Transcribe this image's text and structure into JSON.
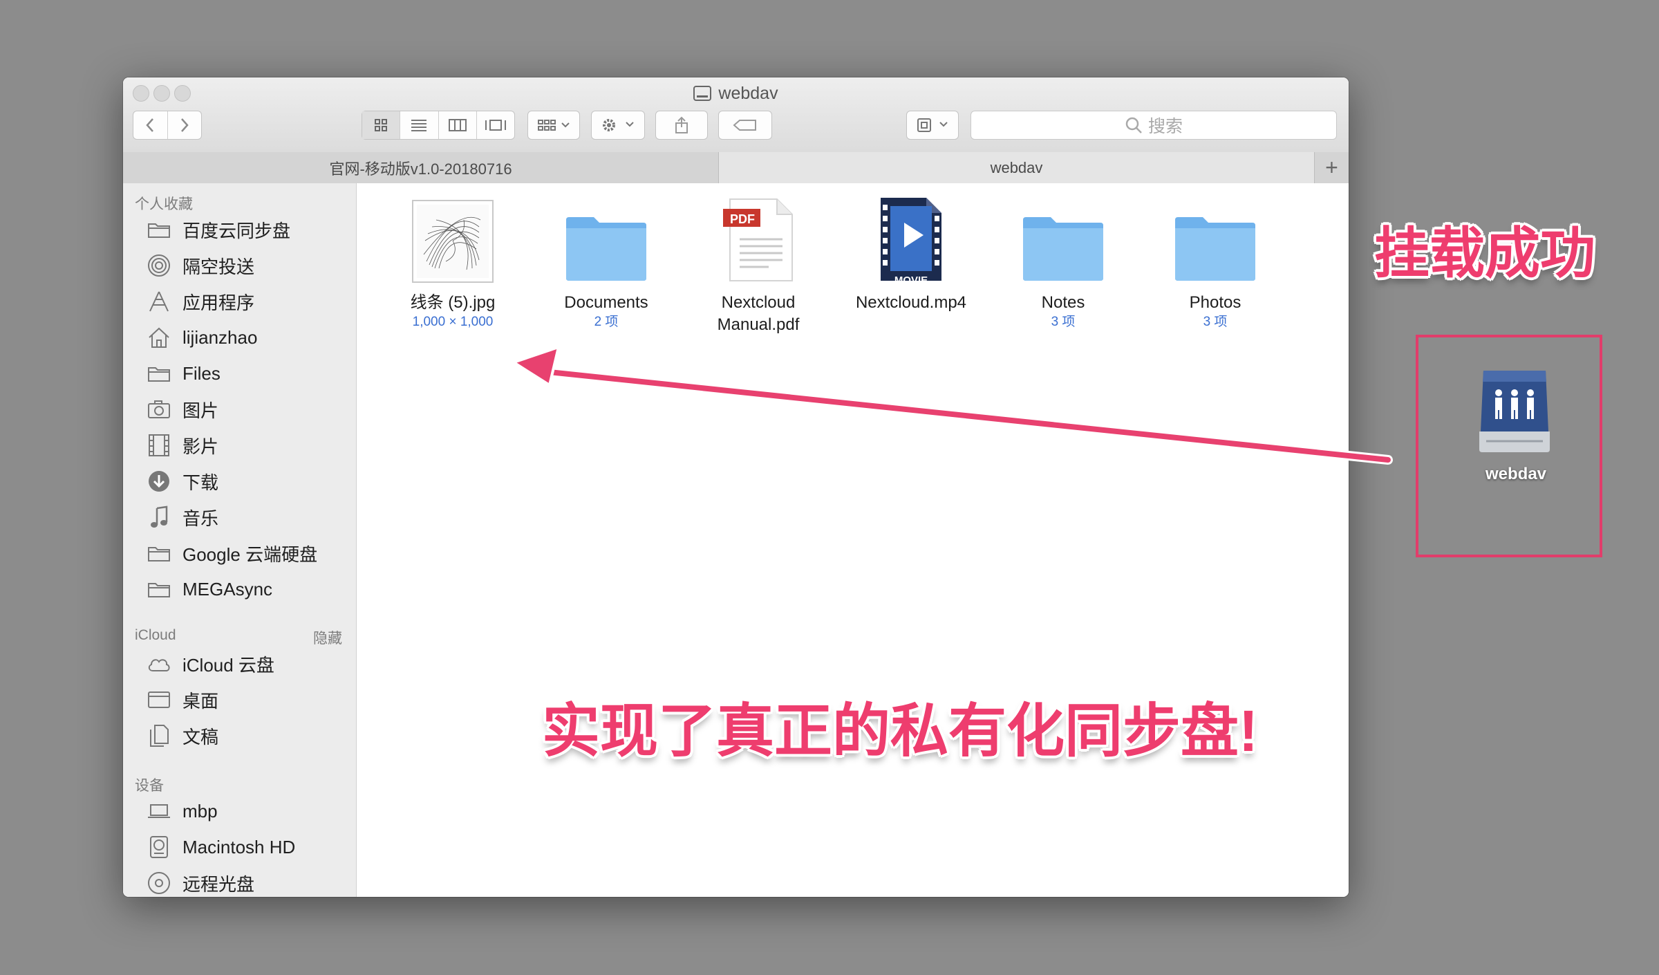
{
  "window": {
    "title": "webdav",
    "tabs": [
      "官网-移动版v1.0-20180716",
      "webdav"
    ],
    "add_tab": "+"
  },
  "search": {
    "placeholder": "搜索"
  },
  "sidebar": {
    "favorites_header": "个人收藏",
    "favorites": [
      {
        "label": "百度云同步盘",
        "icon": "folder-icon"
      },
      {
        "label": "隔空投送",
        "icon": "airdrop-icon"
      },
      {
        "label": "应用程序",
        "icon": "applications-icon"
      },
      {
        "label": "lijianzhao",
        "icon": "home-icon"
      },
      {
        "label": "Files",
        "icon": "folder-icon"
      },
      {
        "label": "图片",
        "icon": "camera-icon"
      },
      {
        "label": "影片",
        "icon": "film-icon"
      },
      {
        "label": "下载",
        "icon": "download-icon"
      },
      {
        "label": "音乐",
        "icon": "music-icon"
      },
      {
        "label": "Google 云端硬盘",
        "icon": "folder-icon"
      },
      {
        "label": "MEGAsync",
        "icon": "folder-icon"
      }
    ],
    "icloud_header": "iCloud",
    "icloud_hide": "隐藏",
    "icloud": [
      {
        "label": "iCloud 云盘",
        "icon": "cloud-icon"
      },
      {
        "label": "桌面",
        "icon": "desktop-icon"
      },
      {
        "label": "文稿",
        "icon": "document-icon"
      }
    ],
    "devices_header": "设备",
    "devices": [
      {
        "label": "mbp",
        "icon": "laptop-icon"
      },
      {
        "label": "Macintosh HD",
        "icon": "harddisk-icon"
      },
      {
        "label": "远程光盘",
        "icon": "disc-icon"
      }
    ]
  },
  "files": [
    {
      "name": "线条 (5).jpg",
      "meta": "1,000 × 1,000",
      "icon": "image-thumbnail-icon"
    },
    {
      "name": "Documents",
      "meta": "2 项",
      "icon": "folder-icon"
    },
    {
      "name": "Nextcloud\nManual.pdf",
      "meta": "",
      "icon": "pdf-icon",
      "badge": "PDF"
    },
    {
      "name": "Nextcloud.mp4",
      "meta": "",
      "icon": "movie-icon",
      "badge": "MOVIE"
    },
    {
      "name": "Notes",
      "meta": "3 项",
      "icon": "folder-icon"
    },
    {
      "name": "Photos",
      "meta": "3 项",
      "icon": "folder-icon"
    }
  ],
  "annotations": {
    "mounted": "挂载成功",
    "private_sync": "实现了真正的私有化同步盘!"
  },
  "desktop": {
    "drive_label": "webdav"
  },
  "colors": {
    "annotation": "#ee3d6e",
    "folder": "#7fbdf0",
    "meta_text": "#3a6fd1"
  }
}
